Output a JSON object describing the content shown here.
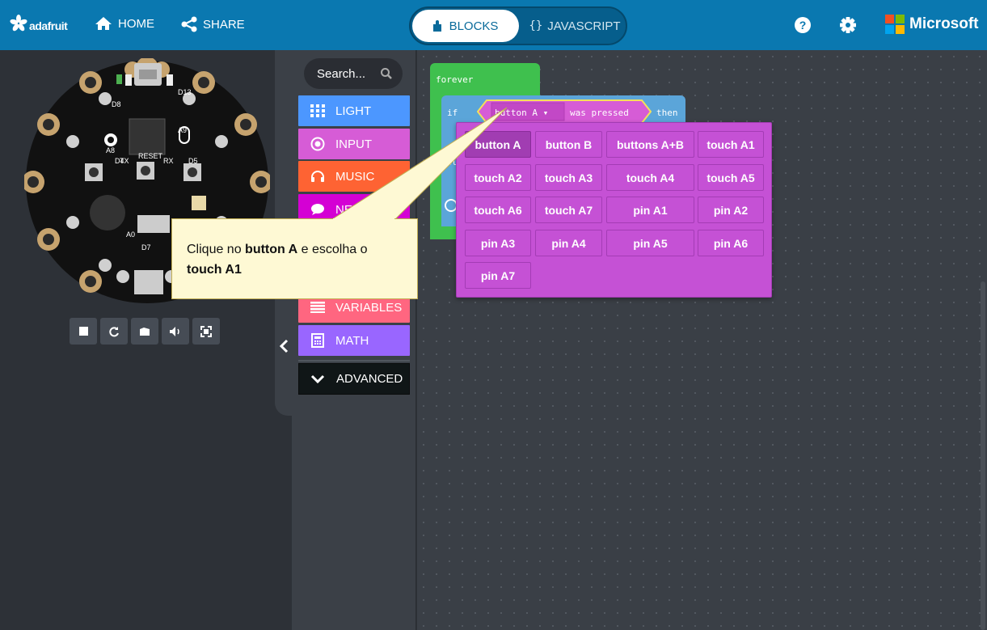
{
  "header": {
    "logo": "adafruit",
    "home": "HOME",
    "share": "SHARE",
    "tab_blocks": "BLOCKS",
    "tab_js_glyph": "{}",
    "tab_js": "JAVASCRIPT",
    "brand": "Microsoft"
  },
  "simulator": {
    "controls": [
      "stop-icon",
      "restart-icon",
      "debug-icon",
      "mute-icon",
      "fullscreen-icon"
    ]
  },
  "toolbox": {
    "search_placeholder": "Search...",
    "categories": [
      {
        "label": "LIGHT",
        "color": "#4c97ff",
        "icon": "grid-icon"
      },
      {
        "label": "INPUT",
        "color": "#d65cd6",
        "icon": "target-icon"
      },
      {
        "label": "MUSIC",
        "color": "#fe6333",
        "icon": "headphones-icon"
      },
      {
        "label": "NETWORK",
        "color": "#d400d4",
        "icon": "chat-icon"
      },
      {
        "label": "VARIABLES",
        "color": "#ff6680",
        "icon": "lines-icon"
      },
      {
        "label": "MATH",
        "color": "#9966ff",
        "icon": "calculator-icon"
      }
    ],
    "advanced": "ADVANCED"
  },
  "workspace": {
    "forever": "forever",
    "if": "if",
    "else": "el",
    "then": "then",
    "button_field": "button A",
    "was_pressed": "was pressed"
  },
  "dropdown": {
    "rows": [
      [
        "button A",
        "button B",
        "buttons A+B",
        "touch A1"
      ],
      [
        "touch A2",
        "touch A3",
        "touch A4",
        "touch A5"
      ],
      [
        "touch A6",
        "touch A7",
        "pin A1",
        "pin A2"
      ],
      [
        "pin A3",
        "pin A4",
        "pin A5",
        "pin A6"
      ],
      [
        "pin A7"
      ]
    ],
    "selected": "button A"
  },
  "callout": {
    "text_1": "Clique no ",
    "bold_1": "button A",
    "text_2": " e escolha o ",
    "bold_2": "touch A1"
  }
}
